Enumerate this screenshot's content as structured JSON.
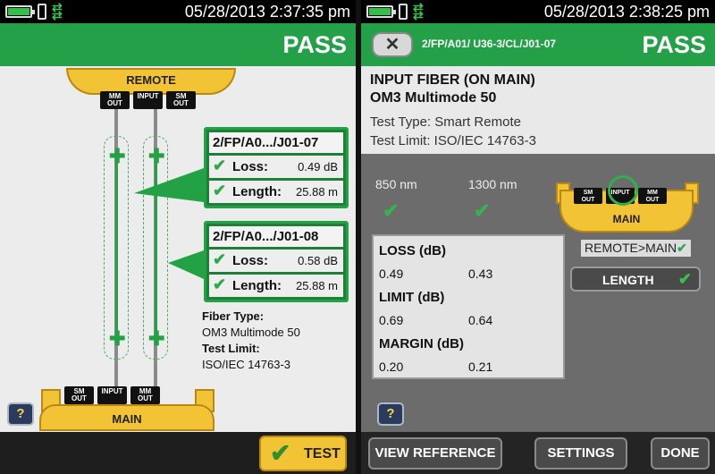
{
  "left": {
    "status": {
      "time": "05/28/2013 2:37:35 pm"
    },
    "header": {
      "status": "PASS"
    },
    "remote_label": "REMOTE",
    "remote_ports": [
      {
        "line1": "SM",
        "line2": "OUT"
      },
      {
        "line1": "INPUT",
        "line2": ""
      },
      {
        "line1": "SM",
        "line2": "OUT"
      }
    ],
    "main_label": "MAIN",
    "main_ports": [
      {
        "line1": "SM",
        "line2": "OUT"
      },
      {
        "line1": "INPUT",
        "line2": ""
      },
      {
        "line1": "MM",
        "line2": "OUT"
      }
    ],
    "remote_mm_port": {
      "line1": "MM",
      "line2": "OUT"
    },
    "results": [
      {
        "title": "2/FP/A0.../J01-07",
        "loss_label": "Loss:",
        "loss_value": "0.49 dB",
        "length_label": "Length:",
        "length_value": "25.88 m"
      },
      {
        "title": "2/FP/A0.../J01-08",
        "loss_label": "Loss:",
        "loss_value": "0.58 dB",
        "length_label": "Length:",
        "length_value": "25.88 m"
      }
    ],
    "fiber_type_label": "Fiber Type:",
    "fiber_type_value": "OM3 Multimode 50",
    "test_limit_label": "Test Limit:",
    "test_limit_value": "ISO/IEC 14763-3",
    "help_label": "?",
    "test_button": "TEST"
  },
  "right": {
    "status": {
      "time": "05/28/2013 2:38:25 pm"
    },
    "header": {
      "status": "PASS",
      "path": "2/FP/A01/ U36-3/CL/J01-07",
      "back_icon": "x-icon"
    },
    "title_line1": "INPUT FIBER (ON MAIN)",
    "title_line2": "OM3 Multimode 50",
    "test_type": "Test Type: Smart Remote",
    "test_limit": "Test Limit: ISO/IEC 14763-3",
    "wavelengths": [
      "850 nm",
      "1300 nm"
    ],
    "main_ports": [
      {
        "line1": "SM",
        "line2": "OUT"
      },
      {
        "line1": "INPUT",
        "line2": ""
      },
      {
        "line1": "MM",
        "line2": "OUT"
      }
    ],
    "main_label": "MAIN",
    "loss_header": "LOSS (dB)",
    "loss_values": [
      "0.49",
      "0.43"
    ],
    "limit_header": "LIMIT (dB)",
    "limit_values": [
      "0.69",
      "0.64"
    ],
    "margin_header": "MARGIN (dB)",
    "margin_values": [
      "0.20",
      "0.21"
    ],
    "direction": "REMOTE>MAIN",
    "length_button": "LENGTH",
    "help_label": "?",
    "footer": {
      "view_reference": "VIEW REFERENCE",
      "settings": "SETTINGS",
      "done": "DONE"
    }
  },
  "colors": {
    "pass_green": "#24a148",
    "yellow": "#f2c335",
    "status_bg": "#000000"
  }
}
